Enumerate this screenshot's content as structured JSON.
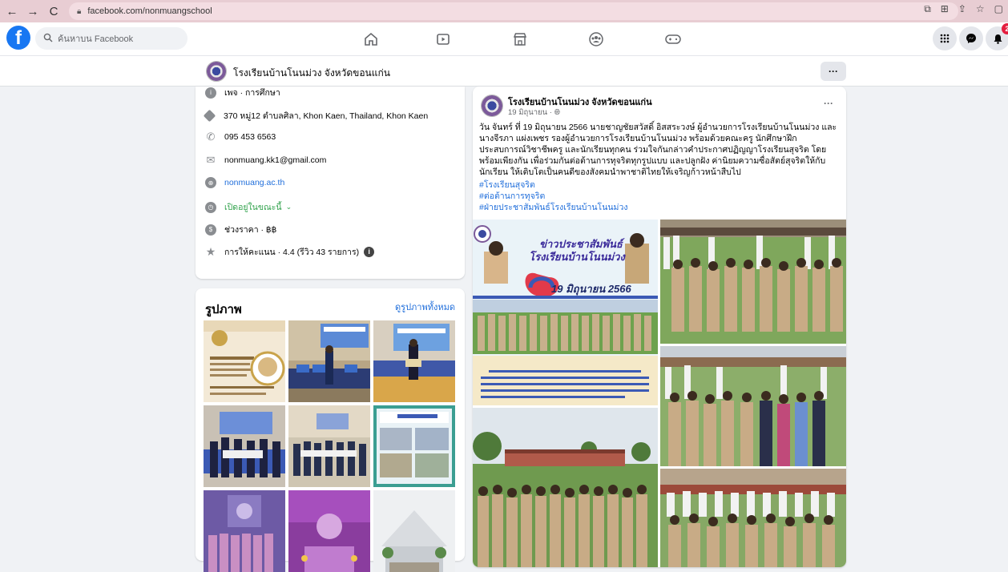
{
  "browser": {
    "back_icon": "←",
    "forward_icon": "→",
    "reload_icon": "C",
    "url": "facebook.com/nonmuangschool",
    "right_icons": [
      "⧉",
      "⊞",
      "⇪",
      "☆",
      "▢"
    ]
  },
  "fb_nav": {
    "logo": "f",
    "search_placeholder": "ค้นหาบน Facebook",
    "notification_count": "2"
  },
  "page_header": {
    "name": "โรงเรียนบ้านโนนม่วง จังหวัดขอนแก่น",
    "more": "···"
  },
  "intro": {
    "category": "เพจ · การศึกษา",
    "address": "370 หมู่12 ตำบลศิลา, Khon Kaen, Thailand, Khon Kaen",
    "phone": "095 453 6563",
    "email": "nonmuang.kk1@gmail.com",
    "website": "nonmuang.ac.th",
    "hours": "เปิดอยู่ในขณะนี้",
    "price": "ช่วงราคา · ฿฿",
    "rating": "การให้คะแนน · 4.4 (รีวิว 43 รายการ)"
  },
  "photos": {
    "title": "รูปภาพ",
    "see_all": "ดูรูปภาพทั้งหมด"
  },
  "post": {
    "author": "โรงเรียนบ้านโนนม่วง จังหวัดขอนแก่น",
    "date": "19 มิถุนายน · ",
    "more": "···",
    "text": "วัน จันทร์ ที่ 19 มิถุนายน 2566 นายชาญชัยสวัสดิ์ อิสสระวงษ์ ผู้อำนวยการโรงเรียนบ้านโนนม่วง และ นางจีรภา แผ่งเพชร รองผู้อำนวยการโรงเรียนบ้านโนนม่วง พร้อมด้วยคณะครู นักศึกษาฝึกประสบการณ์วิชาชีพครู และนักเรียนทุกคน ร่วมใจกันกล่าวคำประกาศปฏิญญาโรงเรียนสุจริต โดยพร้อมเพียงกัน เพื่อร่วมกันต่อต้านการทุจริตทุกรูปแบบ และปลูกฝัง ค่านิยมความซื่อสัตย์สุจริตให้กับนักเรียน ให้เติบโตเป็นคนดีของสังคมนำพาชาติไทยให้เจริญก้าวหน้าสืบไป",
    "hashtags": [
      "#โรงเรียนสุจริต",
      "#ต่อต้านการทุจริต",
      "#ฝ่ายประชาสัมพันธ์โรงเรียนบ้านโนนม่วง"
    ],
    "poster_title1": "ข่าวประชาสัมพันธ์",
    "poster_title2": "โรงเรียนบ้านโนนม่วง",
    "poster_date": "19 มิถุนายน 2566"
  },
  "colors": {
    "fb_blue": "#1877f2",
    "link_blue": "#216fdb",
    "open_green": "#31a24c",
    "browser_bar": "#e8cdd3"
  }
}
